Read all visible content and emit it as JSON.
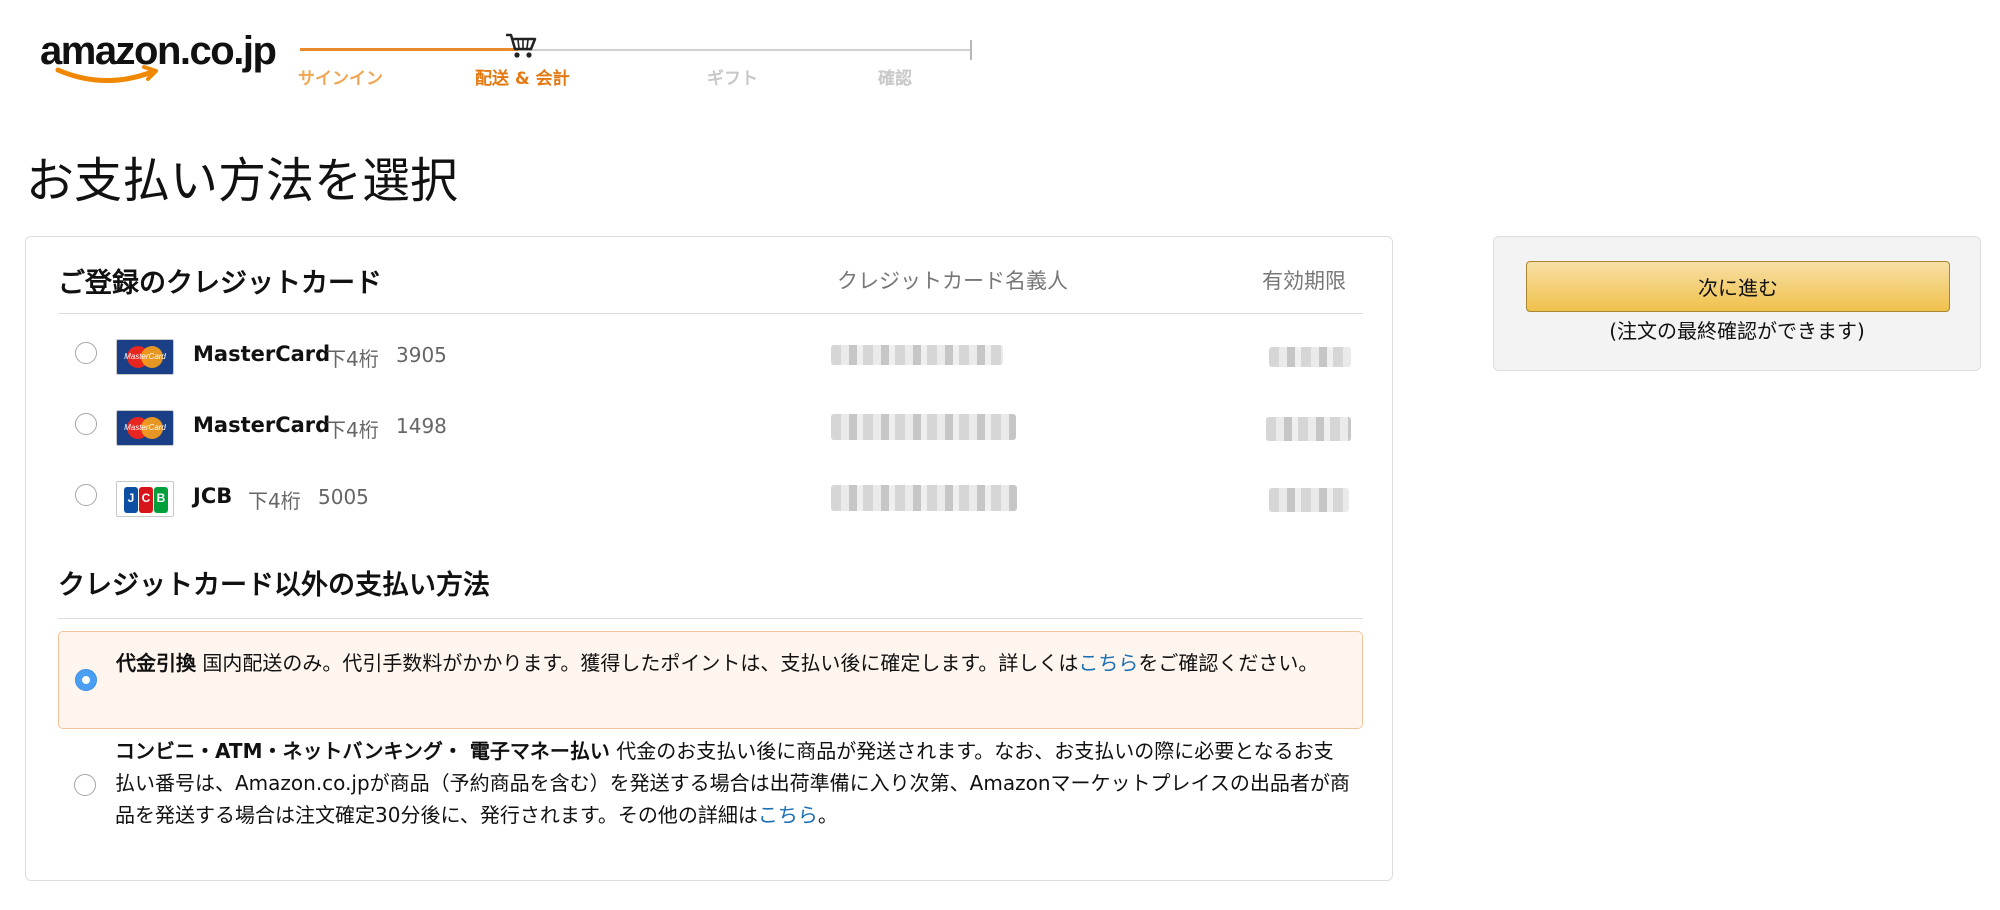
{
  "header": {
    "logo_text": "amazon.co.jp",
    "steps": [
      {
        "label": "サインイン",
        "state": "done"
      },
      {
        "label": "配送 & 会計",
        "state": "current"
      },
      {
        "label": "ギフト",
        "state": "pending"
      },
      {
        "label": "確認",
        "state": "pending"
      }
    ],
    "icons": {
      "cart": "shopping-cart-icon"
    }
  },
  "page": {
    "title": "お支払い方法を選択"
  },
  "credit_cards": {
    "heading": "ご登録のクレジットカード",
    "col_holder": "クレジットカード名義人",
    "col_expiry": "有効期限",
    "cards": [
      {
        "brand": "MasterCard",
        "digits_label": "下4桁",
        "last4": "3905",
        "holder_blurred": true,
        "expiry_blurred": true,
        "selected": false
      },
      {
        "brand": "MasterCard",
        "digits_label": "下4桁",
        "last4": "1498",
        "holder_blurred": true,
        "expiry_blurred": true,
        "selected": false
      },
      {
        "brand": "JCB",
        "digits_label": "下4桁",
        "last4": "5005",
        "holder_blurred": true,
        "expiry_blurred": true,
        "selected": false
      }
    ]
  },
  "other_methods": {
    "heading": "クレジットカード以外の支払い方法",
    "cod": {
      "title": "代金引換",
      "desc": "国内配送のみ。代引手数料がかかります。獲得したポイントは、支払い後に確定します。詳しくは",
      "link": "こちら",
      "suffix": "をご確認ください。",
      "selected": true
    },
    "convenience": {
      "title": "コンビニ・ATM・ネットバンキング・ 電子マネー払い",
      "desc": "代金のお支払い後に商品が発送されます。なお、お支払いの際に必要となるお支払い番号は、Amazon.co.jpが商品（予約商品を含む）を発送する場合は出荷準備に入り次第、Amazonマーケットプレイスの出品者が商品を発送する場合は注文確定30分後に、発行されます。その他の詳細は",
      "link": "こちら",
      "suffix": "。",
      "selected": false
    }
  },
  "sidebar": {
    "continue_label": "次に進む",
    "continue_note": "(注文の最終確認ができます)"
  },
  "colors": {
    "accent_orange": "#e47911",
    "link_blue": "#1a6fb5",
    "button_yellow": "#f0c14b",
    "selected_bg": "#fef5ee",
    "radio_selected": "#4a9ff2"
  }
}
